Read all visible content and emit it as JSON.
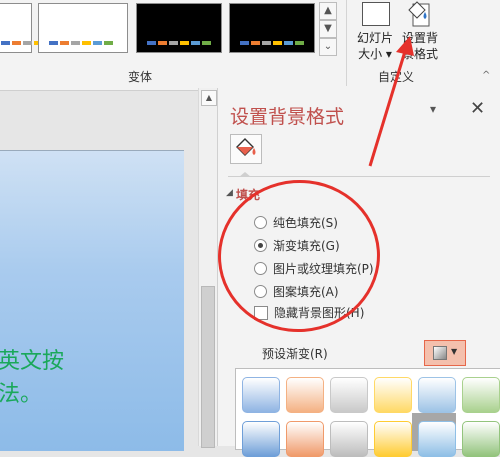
{
  "ribbon": {
    "variant_group_label": "变体",
    "custom_group_label": "自定义",
    "scroll_up": "▲",
    "scroll_down": "▼",
    "scroll_more": "⌄",
    "slide_size": {
      "line1": "幻灯片",
      "line2": "大小 ▾"
    },
    "format_background": {
      "line1": "设置背",
      "line2": "景格式"
    },
    "collapse": "^"
  },
  "variants": [
    {
      "bg": "#ffffff",
      "bars": [
        "#4472c4",
        "#ed7d31",
        "#a5a5a5",
        "#ffc000",
        "#5b9bd5",
        "#70ad47"
      ]
    },
    {
      "bg": "#ffffff",
      "bars": [
        "#4472c4",
        "#ed7d31",
        "#a5a5a5",
        "#ffc000",
        "#5b9bd5",
        "#70ad47"
      ]
    },
    {
      "bg": "#000000",
      "bars": [
        "#4472c4",
        "#ed7d31",
        "#a5a5a5",
        "#ffc000",
        "#5b9bd5",
        "#70ad47"
      ]
    },
    {
      "bg": "#000000",
      "bars": [
        "#4472c4",
        "#ed7d31",
        "#a5a5a5",
        "#ffc000",
        "#5b9bd5",
        "#70ad47"
      ]
    }
  ],
  "slide": {
    "line1": "英文按",
    "line2": "法。"
  },
  "pane": {
    "title": "设置背景格式",
    "menu_caret": "▾",
    "close": "✕",
    "section": "填充",
    "section_arrow": "◢",
    "options": [
      {
        "label": "纯色填充(S)",
        "selected": false
      },
      {
        "label": "渐变填充(G)",
        "selected": true
      },
      {
        "label": "图片或纹理填充(P)",
        "selected": false
      },
      {
        "label": "图案填充(A)",
        "selected": false
      }
    ],
    "hide_graphics": "隐藏背景图形(H)",
    "preset_label": "预设渐变(R)",
    "preset_caret": "▼"
  },
  "gradient_presets": [
    "#8fb4e3",
    "#f4b183",
    "#c9c9c9",
    "#ffd966",
    "#9dc3e6",
    "#a9d18e",
    "#6f9fd8",
    "#f09a6a",
    "#bdbdbd",
    "#ffcc33",
    "#8fbfe6",
    "#93c47d"
  ],
  "colors": {
    "accent": "#c0504d",
    "annotation": "#e5312b",
    "text_green": "#1aa85a"
  }
}
